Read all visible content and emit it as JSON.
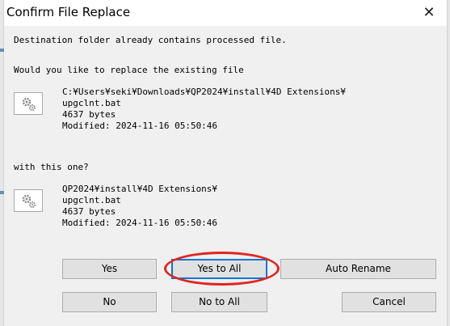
{
  "window": {
    "title": "Confirm File Replace",
    "close_glyph": "✕"
  },
  "message": {
    "line1": "Destination folder already contains processed file.",
    "line2": "Would you like to replace the existing file",
    "line3": "with this one?"
  },
  "existing_file": {
    "path": "C:¥Users¥seki¥Downloads¥QP2024¥install¥4D Extensions¥",
    "name": "upgclnt.bat",
    "size": "4637 bytes",
    "modified": "Modified: 2024-11-16 05:50:46"
  },
  "new_file": {
    "path": "QP2024¥install¥4D Extensions¥",
    "name": "upgclnt.bat",
    "size": "4637 bytes",
    "modified": "Modified: 2024-11-16 05:50:46"
  },
  "buttons": {
    "yes": "Yes",
    "yes_to_all": "Yes to All",
    "auto_rename": "Auto Rename",
    "no": "No",
    "no_to_all": "No to All",
    "cancel": "Cancel"
  },
  "icons": {
    "file": "settings-file-icon",
    "close": "close-icon"
  },
  "colors": {
    "annotation": "#e0261f",
    "default_button_border": "#0078d7"
  }
}
